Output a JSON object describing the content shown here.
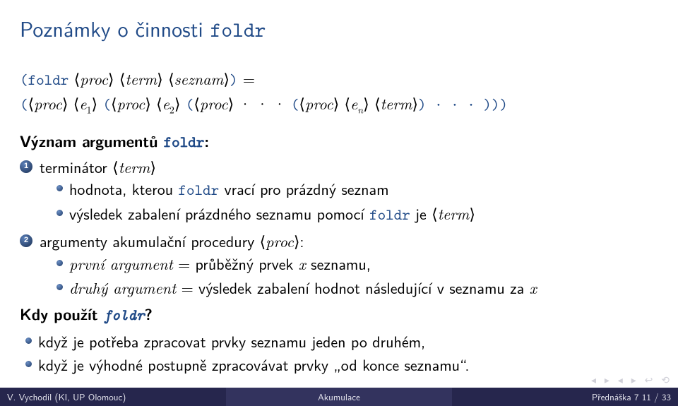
{
  "title_pre": "Poznámky o činnosti ",
  "title_code": "foldr",
  "expr": {
    "lp": "(",
    "rp": ")",
    "foldr": "foldr",
    "proc": "proc",
    "term": "term",
    "seznam": "seznam",
    "eq": " = ",
    "e1": "e",
    "sub1": "1",
    "e2": "e",
    "sub2": "2",
    "dots": " · · · ",
    "en": "e",
    "subn": "n",
    "rps": ") · · · )))"
  },
  "sec1_head": "Význam argumentů ",
  "sec1_code": "foldr",
  "colon": ":",
  "num1": "1",
  "num2": "2",
  "item1_pre": "terminátor ",
  "item1_term": "term",
  "item1_b1_pre": "hodnota, kterou ",
  "item1_b1_code": "foldr",
  "item1_b1_post": " vrací pro prázdný seznam",
  "item1_b2_pre": "výsledek zabalení prázdného seznamu pomocí ",
  "item1_b2_code": "foldr",
  "item1_b2_mid": " je ",
  "item1_b2_term": "term",
  "item2_pre": "argumenty akumulační procedury ",
  "item2_proc": "proc",
  "item2_b1_it": "první argument",
  "item2_b1_post": " = průběžný prvek ",
  "item2_b1_x": "x",
  "item2_b1_end": " seznamu,",
  "item2_b2_it": "druhý argument",
  "item2_b2_post": " = výsledek zabalení hodnot následující v seznamu za ",
  "item2_b2_x": "x",
  "sec2_head": "Kdy použít ",
  "sec2_code": "foldr",
  "sec2_q": "?",
  "sec2_b1": "když je potřeba zpracovat prvky seznamu jeden po druhém,",
  "sec2_b2": "když je výhodné postupně zpracovávat prvky „od konce seznamu“.",
  "footer": {
    "left": "V. Vychodil (KI, UP Olomouc)",
    "mid": "Akumulace",
    "right": "Přednáška 7      11 / 33"
  },
  "angle_l": "⟨",
  "angle_r": "⟩"
}
